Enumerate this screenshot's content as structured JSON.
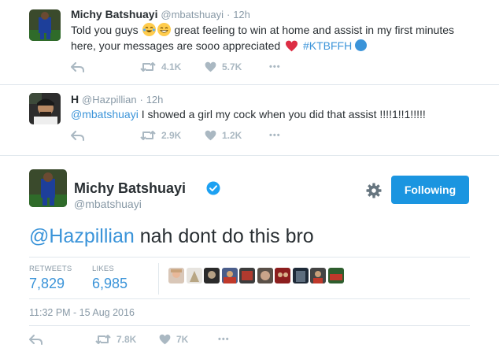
{
  "tweet1": {
    "name": "Michy Batshuayi",
    "handle": "@mbatshuayi",
    "dot": "·",
    "time": "12h",
    "text_a": "Told you guys",
    "text_b": "great feeling to win at home and assist in my first minutes",
    "text_c": "here, your messages are sooo appreciated",
    "hashtag": "#KTBFFH",
    "retweets": "4.1K",
    "likes": "5.7K",
    "more": "•••",
    "emoji_1": "face-with-tears-of-joy-icon",
    "emoji_2": "grinning-face-icon"
  },
  "tweet2": {
    "name": "H",
    "handle": "@Hazpillian",
    "dot": "·",
    "time": "12h",
    "mention": "@mbatshuayi",
    "text": "I showed a girl my cock when you did that assist !!!!1!!1!!!!!",
    "retweets": "2.9K",
    "likes": "1.2K",
    "more": "•••"
  },
  "main": {
    "name": "Michy Batshuayi",
    "handle": "@mbatshuayi",
    "follow_label": "Following",
    "mention": "@Hazpillian",
    "text": "nah dont do this bro",
    "retweets_label": "RETWEETS",
    "retweets": "7,829",
    "likes_label": "LIKES",
    "likes": "6,985",
    "timestamp": "11:32 PM - 15 Aug 2016",
    "action_retweets": "7.8K",
    "action_likes": "7K",
    "more": "•••"
  },
  "colors": {
    "link": "#3b94d9",
    "follow_button": "#1b95e0",
    "muted": "#8899a6",
    "icon": "#aab8c2",
    "heart": "#e0245e"
  }
}
